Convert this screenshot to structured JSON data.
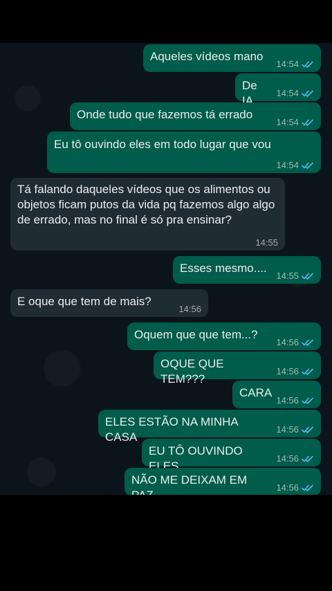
{
  "colors": {
    "chat_background": "#0b141a",
    "outgoing_bubble": "#005c4b",
    "incoming_bubble": "#202c33",
    "read_ticks": "#53bdeb",
    "text": "#e9edef"
  },
  "messages": [
    {
      "direction": "out",
      "text": "Aqueles vídeos mano",
      "time": "14:54",
      "status": "read"
    },
    {
      "direction": "out",
      "text": "De IA",
      "time": "14:54",
      "status": "read"
    },
    {
      "direction": "out",
      "text": "Onde tudo que fazemos tá errado",
      "time": "14:54",
      "status": "read"
    },
    {
      "direction": "out",
      "text": "Eu tô ouvindo eles em todo lugar que vou",
      "time": "14:54",
      "status": "read"
    },
    {
      "direction": "in",
      "text": "Tá falando daqueles vídeos que os alimentos ou objetos ficam putos da vida pq fazemos algo algo de errado, mas no final é só pra ensinar?",
      "time": "14:55"
    },
    {
      "direction": "out",
      "text": "Esses mesmo....",
      "time": "14:55",
      "status": "read"
    },
    {
      "direction": "in",
      "text": "E oque que tem de mais?",
      "time": "14:56"
    },
    {
      "direction": "out",
      "text": "Oquem que que tem...?",
      "time": "14:56",
      "status": "read"
    },
    {
      "direction": "out",
      "text": "OQUE QUE TEM???",
      "time": "14:56",
      "status": "read"
    },
    {
      "direction": "out",
      "text": "CARA",
      "time": "14:56",
      "status": "read"
    },
    {
      "direction": "out",
      "text": "ELES ESTÃO NA MINHA CASA",
      "time": "14:56",
      "status": "read"
    },
    {
      "direction": "out",
      "text": "EU TÔ OUVINDO ELES",
      "time": "14:56",
      "status": "read"
    },
    {
      "direction": "out",
      "text": "NÃO ME DEIXAM EM PAZ",
      "time": "14:56",
      "status": "read"
    }
  ]
}
